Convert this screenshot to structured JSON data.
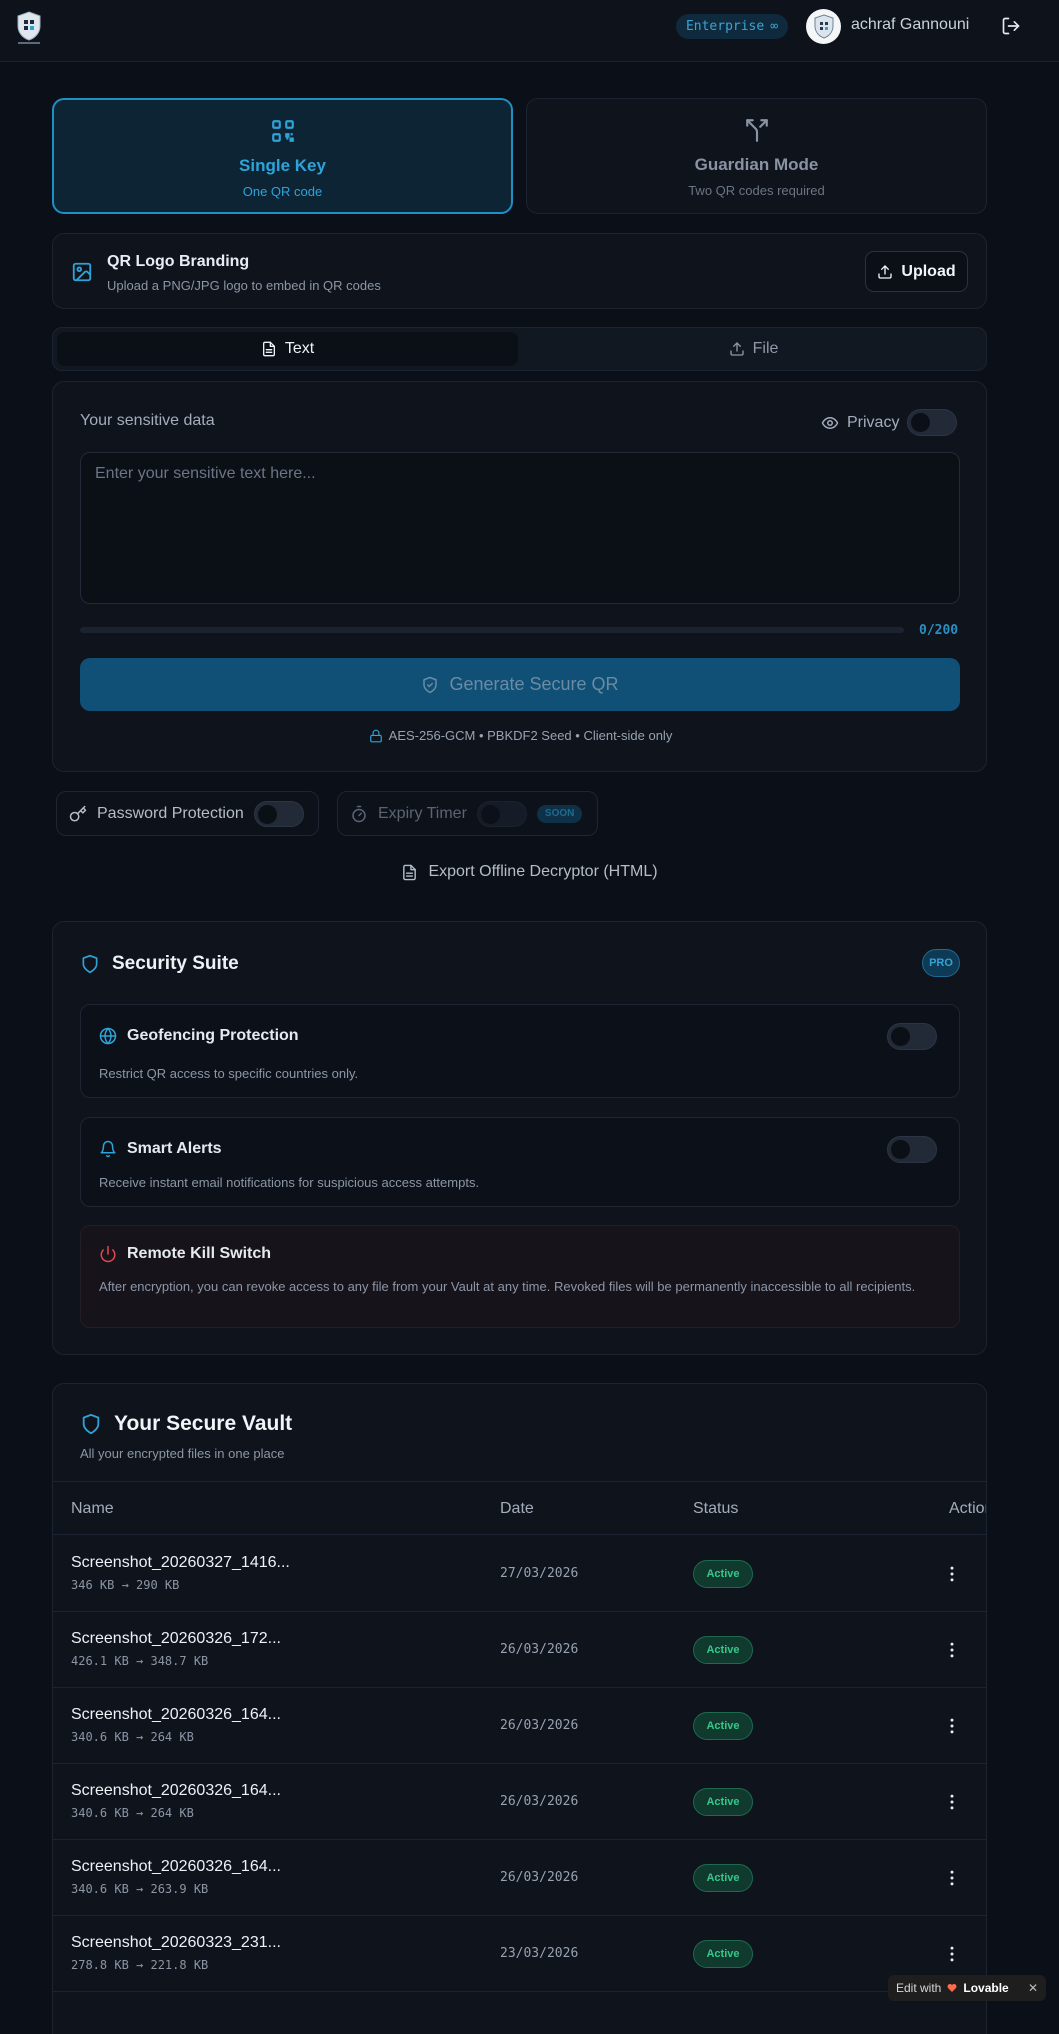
{
  "header": {
    "plan_badge": "Enterprise",
    "plan_symbol": "∞",
    "user_name": "achraf Gannouni"
  },
  "modes": [
    {
      "title": "Single Key",
      "subtitle": "One QR code",
      "selected": true
    },
    {
      "title": "Guardian Mode",
      "subtitle": "Two QR codes required",
      "selected": false
    }
  ],
  "branding": {
    "title": "QR Logo Branding",
    "subtitle": "Upload a PNG/JPG logo to embed in QR codes",
    "upload_label": "Upload"
  },
  "tabs": [
    {
      "label": "Text",
      "active": true
    },
    {
      "label": "File",
      "active": false
    }
  ],
  "data_input": {
    "label": "Your sensitive data",
    "privacy_label": "Privacy",
    "placeholder": "Enter your sensitive text here...",
    "char_count": "0/200",
    "progress": 0,
    "generate_label": "Generate Secure QR",
    "crypto_note": "AES-256-GCM • PBKDF2 Seed • Client-side only"
  },
  "options": {
    "password_label": "Password Protection",
    "expiry_label": "Expiry Timer",
    "expiry_badge": "SOON",
    "export_label": "Export Offline Decryptor (HTML)"
  },
  "security_suite": {
    "title": "Security Suite",
    "badge": "PRO",
    "features": [
      {
        "title": "Geofencing Protection",
        "description": "Restrict QR access to specific countries only."
      },
      {
        "title": "Smart Alerts",
        "description": "Receive instant email notifications for suspicious access attempts."
      },
      {
        "title": "Remote Kill Switch",
        "description": "After encryption, you can revoke access to any file from your Vault at any time. Revoked files will be permanently inaccessible to all recipients."
      }
    ]
  },
  "vault": {
    "title": "Your Secure Vault",
    "subtitle": "All your encrypted files in one place",
    "columns": [
      "Name",
      "Date",
      "Status",
      "Actions"
    ],
    "rows": [
      {
        "name": "Screenshot_20260327_1416...",
        "size": "346 KB → 290 KB",
        "date": "27/03/2026",
        "status": "Active"
      },
      {
        "name": "Screenshot_20260326_172...",
        "size": "426.1 KB → 348.7 KB",
        "date": "26/03/2026",
        "status": "Active"
      },
      {
        "name": "Screenshot_20260326_164...",
        "size": "340.6 KB → 264 KB",
        "date": "26/03/2026",
        "status": "Active"
      },
      {
        "name": "Screenshot_20260326_164...",
        "size": "340.6 KB → 264 KB",
        "date": "26/03/2026",
        "status": "Active"
      },
      {
        "name": "Screenshot_20260326_164...",
        "size": "340.6 KB → 263.9 KB",
        "date": "26/03/2026",
        "status": "Active"
      },
      {
        "name": "Screenshot_20260323_231...",
        "size": "278.8 KB → 221.8 KB",
        "date": "23/03/2026",
        "status": "Active"
      }
    ]
  },
  "lovable_badge": {
    "prefix": "Edit with",
    "brand": "Lovable",
    "close": "✕"
  },
  "colors": {
    "accent": "#1f8fc4",
    "background": "#0b0f17",
    "active_green": "#35c88a",
    "danger": "#e5484d"
  }
}
